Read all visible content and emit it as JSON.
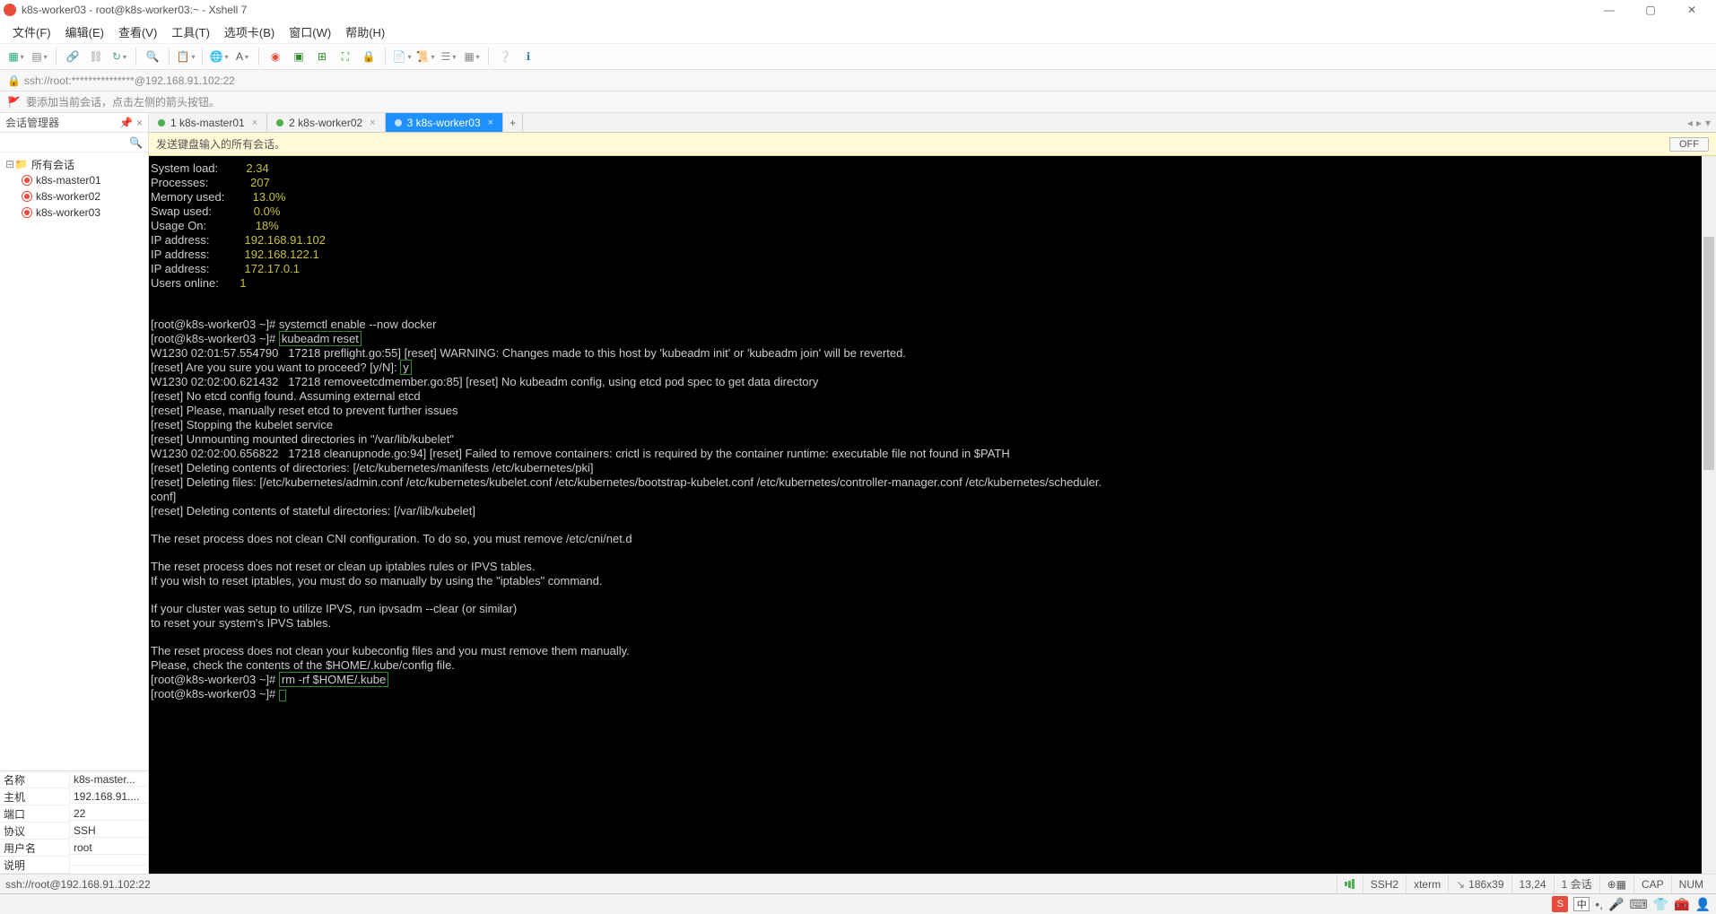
{
  "window": {
    "title": "k8s-worker03 - root@k8s-worker03:~ - Xshell 7",
    "min": "—",
    "max": "▢",
    "close": "✕"
  },
  "menu": {
    "file": "文件(F)",
    "edit": "编辑(E)",
    "view": "查看(V)",
    "tools": "工具(T)",
    "tabs": "选项卡(B)",
    "window": "窗口(W)",
    "help": "帮助(H)"
  },
  "address": "ssh://root:***************@192.168.91.102:22",
  "tip": "要添加当前会话，点击左侧的箭头按钮。",
  "sessmgr": {
    "title": "会话管理器",
    "root": "所有会话",
    "items": [
      "k8s-master01",
      "k8s-worker02",
      "k8s-worker03"
    ]
  },
  "props": {
    "name_k": "名称",
    "name_v": "k8s-master...",
    "host_k": "主机",
    "host_v": "192.168.91....",
    "port_k": "端口",
    "port_v": "22",
    "proto_k": "协议",
    "proto_v": "SSH",
    "user_k": "用户名",
    "user_v": "root",
    "desc_k": "说明",
    "desc_v": ""
  },
  "tabs": {
    "t1": "1 k8s-master01",
    "t2": "2 k8s-worker02",
    "t3": "3 k8s-worker03",
    "add": "+"
  },
  "bcast": {
    "text": "发送键盘输入的所有会话。",
    "off": "OFF"
  },
  "term": {
    "sys_load_k": "System load:",
    "sys_load_v": "2.34",
    "procs_k": "Processes:",
    "procs_v": "207",
    "mem_k": "Memory used:",
    "mem_v": "13.0%",
    "swap_k": "Swap used:",
    "swap_v": "0.0%",
    "usage_k": "Usage On:",
    "usage_v": "18%",
    "ip1_k": "IP address:",
    "ip1_v": "192.168.91.102",
    "ip2_k": "IP address:",
    "ip2_v": "192.168.122.1",
    "ip3_k": "IP address:",
    "ip3_v": "172.17.0.1",
    "users_k": "Users online:",
    "users_v": "1",
    "p1": "[root@k8s-worker03 ~]# systemctl enable --now docker",
    "p2a": "[root@k8s-worker03 ~]# ",
    "p2b": "kubeadm reset",
    "l3": "W1230 02:01:57.554790   17218 preflight.go:55] [reset] WARNING: Changes made to this host by 'kubeadm init' or 'kubeadm join' will be reverted.",
    "l4a": "[reset] Are you sure you want to proceed? [y/N]: ",
    "l4b": "y",
    "l5": "W1230 02:02:00.621432   17218 removeetcdmember.go:85] [reset] No kubeadm config, using etcd pod spec to get data directory",
    "l6": "[reset] No etcd config found. Assuming external etcd",
    "l7": "[reset] Please, manually reset etcd to prevent further issues",
    "l8": "[reset] Stopping the kubelet service",
    "l9": "[reset] Unmounting mounted directories in \"/var/lib/kubelet\"",
    "l10": "W1230 02:02:00.656822   17218 cleanupnode.go:94] [reset] Failed to remove containers: crictl is required by the container runtime: executable file not found in $PATH",
    "l11": "[reset] Deleting contents of directories: [/etc/kubernetes/manifests /etc/kubernetes/pki]",
    "l12": "[reset] Deleting files: [/etc/kubernetes/admin.conf /etc/kubernetes/kubelet.conf /etc/kubernetes/bootstrap-kubelet.conf /etc/kubernetes/controller-manager.conf /etc/kubernetes/scheduler.",
    "l12b": "conf]",
    "l13": "[reset] Deleting contents of stateful directories: [/var/lib/kubelet]",
    "l14": "The reset process does not clean CNI configuration. To do so, you must remove /etc/cni/net.d",
    "l15": "The reset process does not reset or clean up iptables rules or IPVS tables.",
    "l16": "If you wish to reset iptables, you must do so manually by using the \"iptables\" command.",
    "l17": "If your cluster was setup to utilize IPVS, run ipvsadm --clear (or similar)",
    "l18": "to reset your system's IPVS tables.",
    "l19": "The reset process does not clean your kubeconfig files and you must remove them manually.",
    "l20": "Please, check the contents of the $HOME/.kube/config file.",
    "p3a": "[root@k8s-worker03 ~]# ",
    "p3b": "rm -rf $HOME/.kube",
    "p4": "[root@k8s-worker03 ~]# "
  },
  "status": {
    "left": "ssh://root@192.168.91.102:22",
    "ssh": "SSH2",
    "term": "xterm",
    "size": "186x39",
    "pos": "13,24",
    "sess": "1 会话",
    "cap": "CAP",
    "num": "NUM"
  }
}
